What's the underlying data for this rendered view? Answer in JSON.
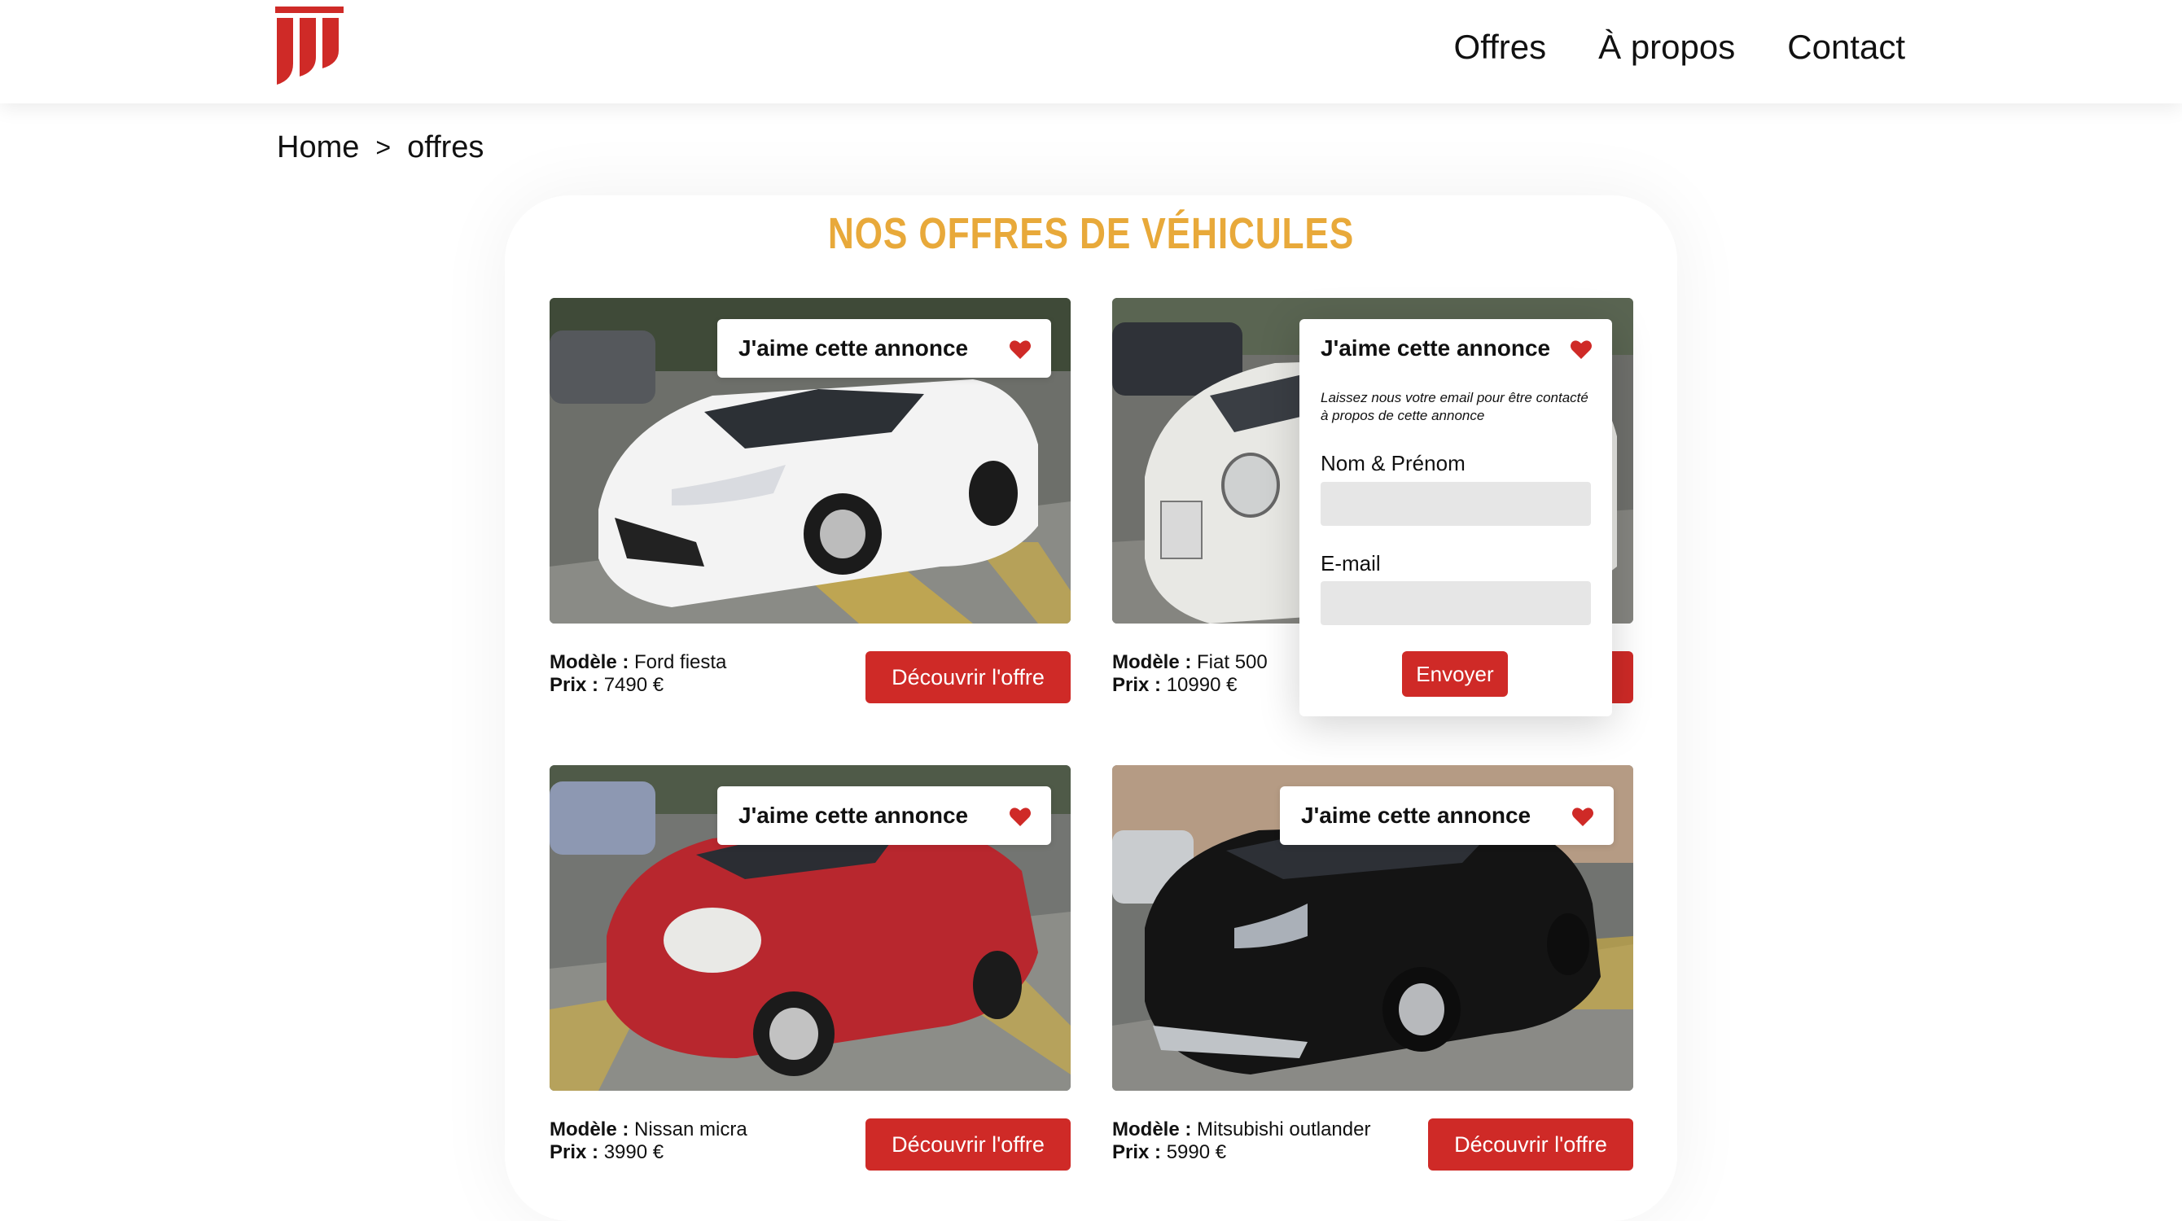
{
  "header": {
    "nav": [
      "Offres",
      "À propos",
      "Contact"
    ],
    "brand_color": "#cf2a27"
  },
  "breadcrumb": {
    "home": "Home",
    "separator": ">",
    "current": "offres"
  },
  "page_title": "NOS OFFRES DE VÉHICULES",
  "like_label": "J'aime cette annonce",
  "model_label": "Modèle :",
  "price_label": "Prix :",
  "discover_label": "Découvrir l'offre",
  "cards": [
    {
      "model": "Ford fiesta",
      "price": "7490 €",
      "car_color": "#f3f3f3"
    },
    {
      "model": "Fiat 500",
      "price": "10990 €",
      "car_color": "#e8e8e4"
    },
    {
      "model": "Nissan micra",
      "price": "3990 €",
      "car_color": "#b8272e"
    },
    {
      "model": "Mitsubishi outlander",
      "price": "5990 €",
      "car_color": "#141414"
    }
  ],
  "popup": {
    "title": "J'aime cette annonce",
    "description": "Laissez nous votre email pour être contacté à propos de cette annonce",
    "name_label": "Nom & Prénom",
    "email_label": "E-mail",
    "submit_label": "Envoyer"
  },
  "colors": {
    "accent": "#cf2a27",
    "title": "#e8a93a"
  }
}
